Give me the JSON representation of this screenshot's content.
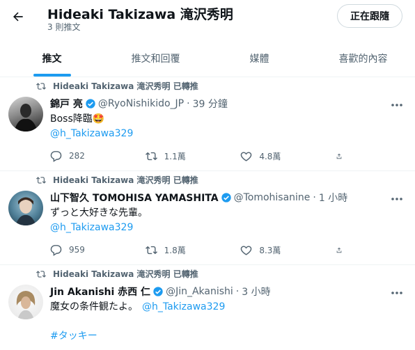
{
  "header": {
    "title": "Hideaki Takizawa 滝沢秀明",
    "subtitle": "3 則推文",
    "follow_button": "正在跟隨"
  },
  "tabs": [
    {
      "label": "推文",
      "active": true
    },
    {
      "label": "推文和回覆",
      "active": false
    },
    {
      "label": "媒體",
      "active": false
    },
    {
      "label": "喜歡的內容",
      "active": false
    }
  ],
  "accent_color": "#1d9bf0",
  "tweets": [
    {
      "retweet_label": "Hideaki Takizawa 滝沢秀明 已轉推",
      "name": "錦戸 亮",
      "verified": true,
      "handle": "@RyoNishikido_JP",
      "dot": "·",
      "time": "39 分鐘",
      "line1": "Boss降臨🤩",
      "mention": "@h_Takizawa329",
      "replies": "282",
      "retweets": "1.1萬",
      "likes": "4.8萬"
    },
    {
      "retweet_label": "Hideaki Takizawa 滝沢秀明 已轉推",
      "name": "山下智久 TOMOHISA YAMASHITA",
      "verified": true,
      "handle": "@Tomohisanine",
      "dot": "·",
      "time": "1 小時",
      "line1": "ずっと大好きな先輩。",
      "mention": "@h_Takizawa329",
      "replies": "959",
      "retweets": "1.8萬",
      "likes": "8.3萬"
    },
    {
      "retweet_label": "Hideaki Takizawa 滝沢秀明 已轉推",
      "name": "Jin Akanishi 赤西 仁",
      "verified": true,
      "handle": "@Jin_Akanishi",
      "dot": "·",
      "time": "3 小時",
      "line1": "魔女の条件観たよ。",
      "mention": "@h_Takizawa329",
      "hashtag": "#タッキー"
    }
  ]
}
